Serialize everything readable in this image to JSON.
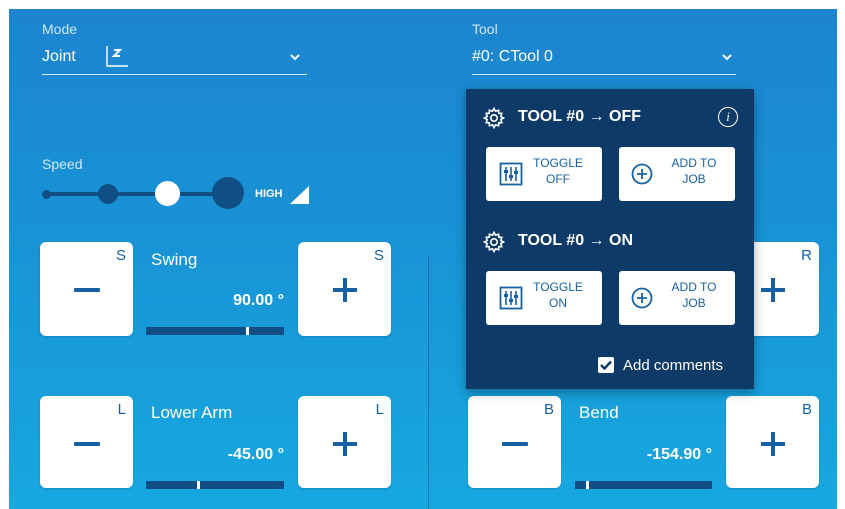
{
  "mode": {
    "label": "Mode",
    "value": "Joint",
    "icon": "joint-axis-icon"
  },
  "tool": {
    "label": "Tool",
    "value": "#0: CTool 0"
  },
  "speed": {
    "label": "Speed",
    "levels": 4,
    "selected_level": 3,
    "high_label": "HIGH"
  },
  "axes": {
    "swing": {
      "name": "Swing",
      "letter": "S",
      "value": "90.00 °",
      "slider_fraction": 0.73
    },
    "lower_arm": {
      "name": "Lower Arm",
      "letter": "L",
      "value": "-45.00 °",
      "slider_fraction": 0.37
    },
    "wrist_r": {
      "letter": "R"
    },
    "bend": {
      "name": "Bend",
      "letter": "B",
      "value": "-154.90 °",
      "slider_fraction": 0.08
    }
  },
  "popup": {
    "off_section": {
      "title": "TOOL #0 → OFF",
      "toggle_line1": "TOGGLE",
      "toggle_line2": "OFF",
      "add_line1": "ADD TO",
      "add_line2": "JOB"
    },
    "on_section": {
      "title": "TOOL #0 → ON",
      "toggle_line1": "TOGGLE",
      "toggle_line2": "ON",
      "add_line1": "ADD TO",
      "add_line2": "JOB"
    },
    "add_comments": {
      "label": "Add comments",
      "checked": true
    }
  },
  "colors": {
    "panel_top": "#1d84cf",
    "panel_bottom": "#17a8e0",
    "accent": "#1660a3",
    "popup_bg": "#0e3a68"
  }
}
